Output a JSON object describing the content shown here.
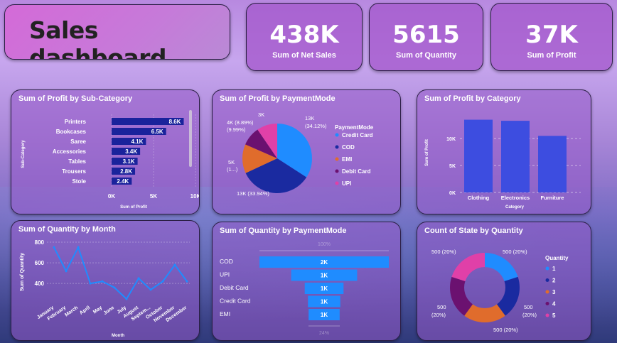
{
  "header": {
    "title": "Sales dashboard"
  },
  "kpis": [
    {
      "value": "438K",
      "label": "Sum of Net Sales"
    },
    {
      "value": "5615",
      "label": "Sum of Quantity"
    },
    {
      "value": "37K",
      "label": "Sum of Profit"
    }
  ],
  "colors": {
    "bar_dark": "#1a239c",
    "bar_blue": "#3d4de0",
    "line_blue": "#1f8cff",
    "orange": "#e06c2c",
    "purple": "#6b1170",
    "pink": "#e040a8",
    "navy": "#1a2aa0"
  },
  "chart_data": [
    {
      "type": "bar",
      "title": "Sum of Profit by Sub-Category",
      "orientation": "horizontal",
      "categories": [
        "Printers",
        "Bookcases",
        "Saree",
        "Accessories",
        "Tables",
        "Trousers",
        "Stole"
      ],
      "values": [
        8600,
        6500,
        4100,
        3400,
        3100,
        2800,
        2400
      ],
      "data_labels": [
        "8.6K",
        "6.5K",
        "4.1K",
        "3.4K",
        "3.1K",
        "2.8K",
        "2.4K"
      ],
      "xlabel": "Sum of Profit",
      "ylabel": "Sub-Category",
      "xticks": [
        "0K",
        "5K",
        "10K"
      ],
      "xlim": [
        0,
        10000
      ]
    },
    {
      "type": "pie",
      "title": "Sum of Profit by PaymentMode",
      "legend_title": "PaymentMode",
      "categories": [
        "Credit Card",
        "COD",
        "EMI",
        "Debit Card",
        "UPI"
      ],
      "values": [
        34.12,
        33.94,
        13.5,
        8.89,
        9.55
      ],
      "data_labels": [
        "13K (34.12%)",
        "13K (33.94%)",
        "5K (1...)",
        "4K (8.89%)",
        "3K (9.99%)"
      ]
    },
    {
      "type": "bar",
      "title": "Sum of Profit by Category",
      "categories": [
        "Clothing",
        "Electronics",
        "Furniture"
      ],
      "values": [
        13500,
        13300,
        10500
      ],
      "xlabel": "Category",
      "ylabel": "Sum of Profit",
      "yticks": [
        "0K",
        "5K",
        "10K"
      ],
      "ylim": [
        0,
        14500
      ]
    },
    {
      "type": "line",
      "title": "Sum of Quantity by Month",
      "categories": [
        "January",
        "February",
        "March",
        "April",
        "May",
        "June",
        "July",
        "August",
        "Septem...",
        "October",
        "November",
        "December"
      ],
      "values": [
        750,
        520,
        750,
        400,
        420,
        360,
        250,
        450,
        340,
        420,
        580,
        420
      ],
      "xlabel": "Month",
      "ylabel": "Sum of Quantity",
      "yticks": [
        "400",
        "600",
        "800"
      ],
      "ylim": [
        250,
        800
      ]
    },
    {
      "type": "bar",
      "title": "Sum of Quantity by PaymentMode",
      "subtype": "funnel",
      "categories": [
        "COD",
        "UPI",
        "Debit Card",
        "Credit Card",
        "EMI"
      ],
      "values": [
        2000,
        1000,
        1000,
        1000,
        1000
      ],
      "data_labels": [
        "2K",
        "1K",
        "1K",
        "1K",
        "1K"
      ],
      "bar_widths_pct": [
        100,
        51,
        30,
        25,
        24
      ],
      "top_label": "100%",
      "bottom_label": "24%"
    },
    {
      "type": "pie",
      "subtype": "donut",
      "title": "Count of State by Quantity",
      "legend_title": "Quantity",
      "categories": [
        "1",
        "2",
        "3",
        "4",
        "5"
      ],
      "values": [
        20,
        20,
        20,
        20,
        20
      ],
      "data_labels": [
        "500 (20%)",
        "500 (20%)",
        "500 (20%)",
        "500 (20%)",
        "500 (20%)"
      ]
    }
  ]
}
